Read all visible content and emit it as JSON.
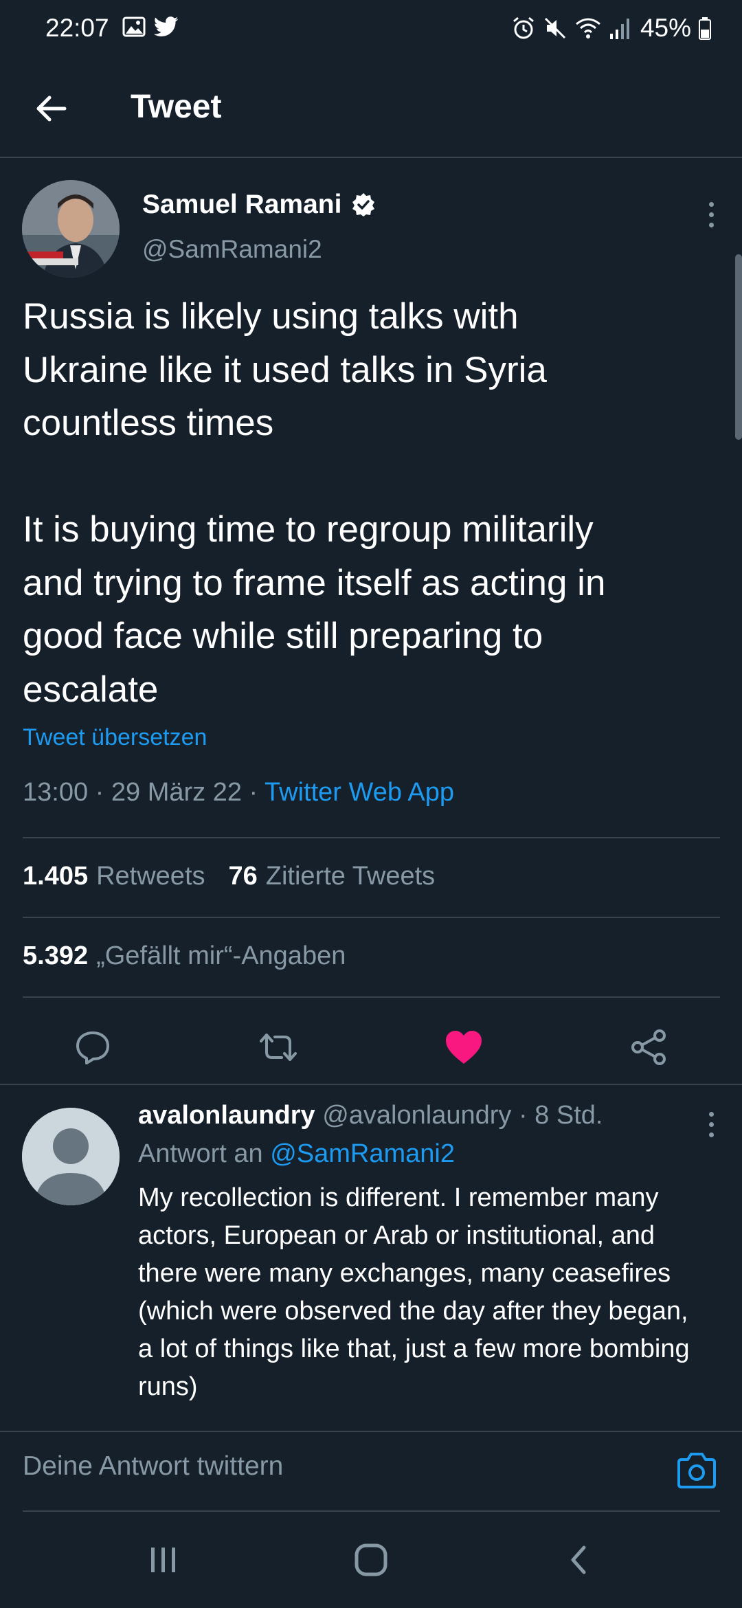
{
  "status_bar": {
    "time": "22:07",
    "battery": "45%"
  },
  "header": {
    "title": "Tweet"
  },
  "tweet": {
    "author_name": "Samuel Ramani",
    "author_handle": "@SamRamani2",
    "text": "Russia is likely using talks with\nUkraine like it used talks in Syria\ncountless times\n\nIt is buying time to regroup militarily\nand trying to frame itself as acting in\ngood face while still preparing to\nescalate",
    "translate_label": "Tweet übersetzen",
    "timestamp": "13:00 · 29 März 22 · ",
    "source": "Twitter Web App",
    "retweets_count": "1.405",
    "retweets_label": "Retweets",
    "quotes_count": "76",
    "quotes_label": "Zitierte Tweets",
    "likes_count": "5.392",
    "likes_label": "„Gefällt mir“-Angaben",
    "liked": true
  },
  "reply": {
    "author_name": "avalonlaundry",
    "author_meta": " @avalonlaundry · 8 Std.",
    "reply_to_label": "Antwort an ",
    "reply_to_handle": "@SamRamani2",
    "text": "My recollection is different.  I remember many actors, European or Arab or institutional, and there were many exchanges, many ceasefires (which were observed the day after they began, a lot of things like that, just a few more bombing runs)"
  },
  "compose": {
    "placeholder": "Deine Antwort twittern"
  },
  "colors": {
    "background": "#15202b",
    "accent": "#1d9bf0",
    "like": "#f91880",
    "muted": "#8899a6",
    "divider": "#38444d"
  },
  "icons": {
    "status_left": [
      "gallery-icon",
      "twitter-bird-icon"
    ],
    "status_right": [
      "alarm-icon",
      "mute-icon",
      "wifi-icon",
      "signal-icon",
      "battery-icon"
    ],
    "actions": [
      "reply-icon",
      "retweet-icon",
      "like-icon",
      "share-icon"
    ],
    "nav": [
      "recent-apps-icon",
      "home-icon",
      "back-nav-icon"
    ]
  }
}
